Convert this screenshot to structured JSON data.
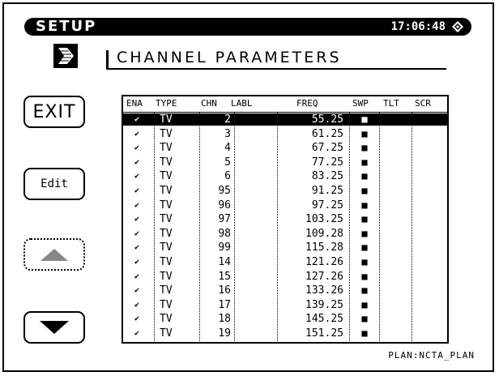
{
  "title_bar": {
    "title": "SETUP",
    "clock": "17:06:48",
    "clock_icon": "diamond-icon"
  },
  "screen": {
    "heading": "CHANNEL PARAMETERS",
    "icon": "arrow-right-icon"
  },
  "softkeys": {
    "exit_label": "EXIT",
    "edit_label": "Edit",
    "up_icon": "triangle-up-icon",
    "down_icon": "triangle-down-icon"
  },
  "table": {
    "columns": [
      "ENA",
      "TYPE",
      "CHN",
      "LABL",
      "FREQ",
      "SWP",
      "TLT",
      "SCR"
    ],
    "selected_row": 0,
    "rows": [
      {
        "ena": "✔",
        "type": "TV",
        "chn": "2",
        "labl": "",
        "freq": "55.25",
        "swp": "■",
        "tlt": "",
        "scr": ""
      },
      {
        "ena": "✔",
        "type": "TV",
        "chn": "3",
        "labl": "",
        "freq": "61.25",
        "swp": "■",
        "tlt": "",
        "scr": ""
      },
      {
        "ena": "✔",
        "type": "TV",
        "chn": "4",
        "labl": "",
        "freq": "67.25",
        "swp": "■",
        "tlt": "",
        "scr": ""
      },
      {
        "ena": "✔",
        "type": "TV",
        "chn": "5",
        "labl": "",
        "freq": "77.25",
        "swp": "■",
        "tlt": "",
        "scr": ""
      },
      {
        "ena": "✔",
        "type": "TV",
        "chn": "6",
        "labl": "",
        "freq": "83.25",
        "swp": "■",
        "tlt": "",
        "scr": ""
      },
      {
        "ena": "✔",
        "type": "TV",
        "chn": "95",
        "labl": "",
        "freq": "91.25",
        "swp": "■",
        "tlt": "",
        "scr": ""
      },
      {
        "ena": "✔",
        "type": "TV",
        "chn": "96",
        "labl": "",
        "freq": "97.25",
        "swp": "■",
        "tlt": "",
        "scr": ""
      },
      {
        "ena": "✔",
        "type": "TV",
        "chn": "97",
        "labl": "",
        "freq": "103.25",
        "swp": "■",
        "tlt": "",
        "scr": ""
      },
      {
        "ena": "✔",
        "type": "TV",
        "chn": "98",
        "labl": "",
        "freq": "109.28",
        "swp": "■",
        "tlt": "",
        "scr": ""
      },
      {
        "ena": "✔",
        "type": "TV",
        "chn": "99",
        "labl": "",
        "freq": "115.28",
        "swp": "■",
        "tlt": "",
        "scr": ""
      },
      {
        "ena": "✔",
        "type": "TV",
        "chn": "14",
        "labl": "",
        "freq": "121.26",
        "swp": "■",
        "tlt": "",
        "scr": ""
      },
      {
        "ena": "✔",
        "type": "TV",
        "chn": "15",
        "labl": "",
        "freq": "127.26",
        "swp": "■",
        "tlt": "",
        "scr": ""
      },
      {
        "ena": "✔",
        "type": "TV",
        "chn": "16",
        "labl": "",
        "freq": "133.26",
        "swp": "■",
        "tlt": "",
        "scr": ""
      },
      {
        "ena": "✔",
        "type": "TV",
        "chn": "17",
        "labl": "",
        "freq": "139.25",
        "swp": "■",
        "tlt": "",
        "scr": ""
      },
      {
        "ena": "✔",
        "type": "TV",
        "chn": "18",
        "labl": "",
        "freq": "145.25",
        "swp": "■",
        "tlt": "",
        "scr": ""
      },
      {
        "ena": "✔",
        "type": "TV",
        "chn": "19",
        "labl": "",
        "freq": "151.25",
        "swp": "■",
        "tlt": "",
        "scr": ""
      }
    ]
  },
  "footer": {
    "plan": "PLAN:NCTA_PLAN"
  }
}
